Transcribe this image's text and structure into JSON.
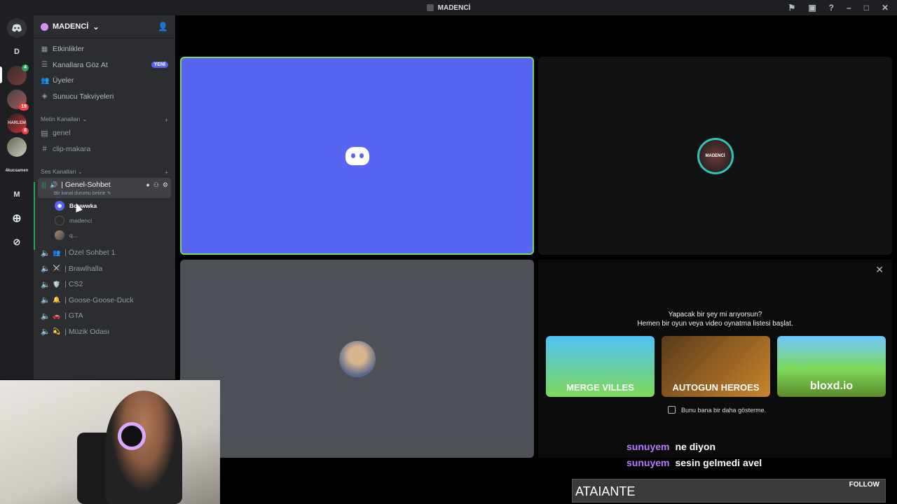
{
  "titlebar": {
    "title": "MADENCİ"
  },
  "guilds": [
    {
      "label": "D"
    },
    {
      "label": "",
      "badge": "4"
    },
    {
      "label": "",
      "badge": "19"
    },
    {
      "label": "HARLEM",
      "badge": "8"
    },
    {
      "label": ""
    },
    {
      "label": "4kucsamen"
    },
    {
      "label": "M"
    }
  ],
  "sidebar": {
    "server_name": "MADENCİ",
    "nav": [
      {
        "label": "Etkinlikler"
      },
      {
        "label": "Kanallara Göz At",
        "badge": "YENİ"
      },
      {
        "label": "Üyeler"
      },
      {
        "label": "Sunucu Takviyeleri"
      }
    ],
    "text_category": "Metin Kanalları",
    "text_channels": [
      {
        "label": "genel"
      },
      {
        "label": "clip-makara"
      }
    ],
    "voice_category": "Ses Kanalları",
    "active_channel": {
      "label": "Genel-Sohbet",
      "status": "Bir kanal durumu belirle"
    },
    "members": [
      {
        "name": "Bouwwka"
      },
      {
        "name": "madenci"
      },
      {
        "name": "q..."
      }
    ],
    "voice_channels": [
      {
        "label": "Özel Sohbet 1",
        "emoji": "👥"
      },
      {
        "label": "Brawlhalla",
        "emoji": "⚔️"
      },
      {
        "label": "CS2",
        "emoji": "🛡️"
      },
      {
        "label": "Goose-Goose-Duck",
        "emoji": "🔔"
      },
      {
        "label": "GTA",
        "emoji": "🚗"
      },
      {
        "label": "Müzik Odası",
        "emoji": "💫"
      }
    ]
  },
  "stage": {
    "server_avatar_text": "MADENCİ"
  },
  "activity": {
    "close": "✕",
    "line1": "Yapacak bir şey mi arıyorsun?",
    "line2": "Hemen bir oyun veya video oynatma listesi başlat.",
    "games": [
      {
        "title": "MERGE VILLES"
      },
      {
        "title": "AUTOGUN HEROES"
      },
      {
        "title": "bloxd.io"
      }
    ],
    "dont_show": "Bunu bana bir daha gösterme."
  },
  "chat": [
    {
      "user": "sunuyem",
      "msg": "ne diyon"
    },
    {
      "user": "sunuyem",
      "msg": "sesin gelmedi avel"
    }
  ],
  "follow": {
    "name": "ATAIANTE",
    "button": "FOLLOW"
  }
}
